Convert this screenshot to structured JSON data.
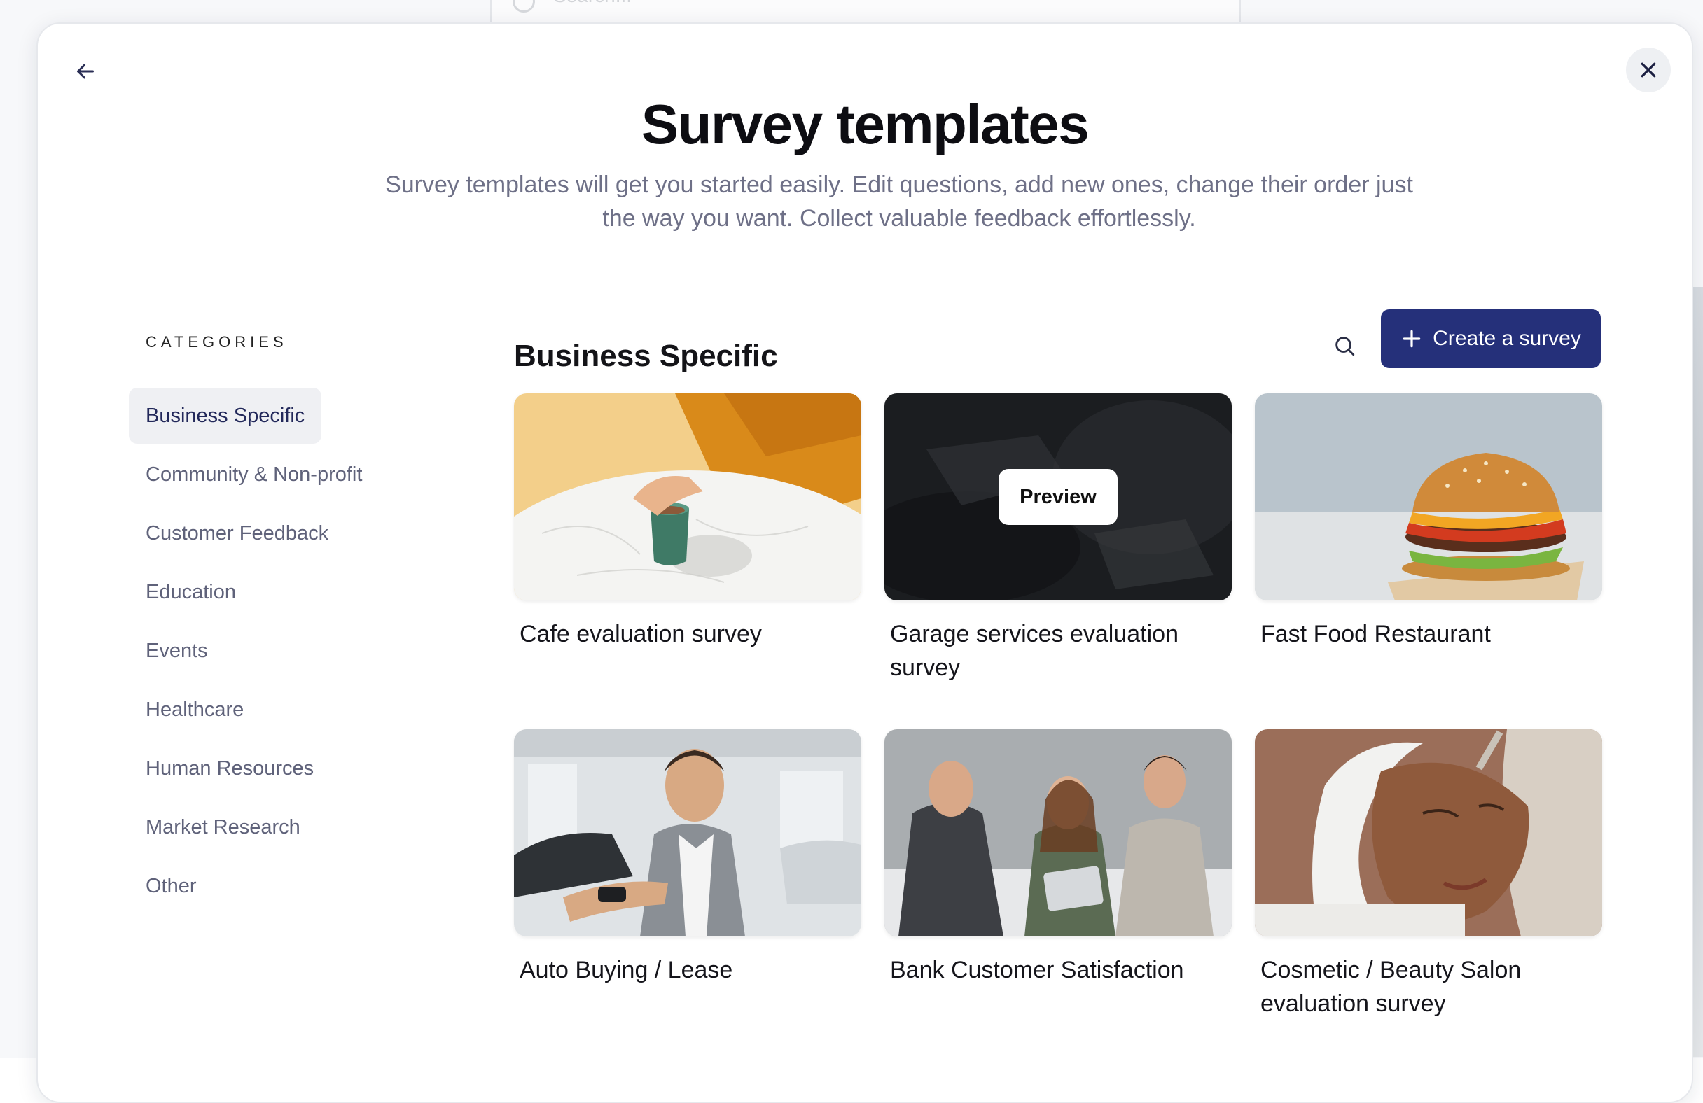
{
  "background": {
    "search_placeholder": "Search..."
  },
  "modal": {
    "title": "Survey templates",
    "subtitle": "Survey templates will get you started easily. Edit questions, add new ones, change their order just the way you want. Collect valuable feedback effortlessly.",
    "icons": {
      "back": "arrow-left-icon",
      "close": "close-icon"
    }
  },
  "sidebar": {
    "heading": "CATEGORIES",
    "items": [
      {
        "label": "Business Specific",
        "active": true
      },
      {
        "label": "Community & Non-profit",
        "active": false
      },
      {
        "label": "Customer Feedback",
        "active": false
      },
      {
        "label": "Education",
        "active": false
      },
      {
        "label": "Events",
        "active": false
      },
      {
        "label": "Healthcare",
        "active": false
      },
      {
        "label": "Human Resources",
        "active": false
      },
      {
        "label": "Market Research",
        "active": false
      },
      {
        "label": "Other",
        "active": false
      }
    ]
  },
  "main": {
    "section_title": "Business Specific",
    "search_icon": "search-icon",
    "create_label": "Create a survey",
    "preview_label": "Preview",
    "templates": [
      {
        "label": "Cafe evaluation survey",
        "image": "coffee-cup-on-marble-table",
        "hovered": false
      },
      {
        "label": "Garage services evaluation survey",
        "image": "mechanic-at-work",
        "hovered": true
      },
      {
        "label": "Fast Food Restaurant",
        "image": "burger",
        "hovered": false
      },
      {
        "label": "Auto Buying / Lease",
        "image": "car-salesman-with-keys",
        "hovered": false
      },
      {
        "label": "Bank Customer Satisfaction",
        "image": "bank-advisor-meeting",
        "hovered": false
      },
      {
        "label": "Cosmetic / Beauty Salon evaluation survey",
        "image": "facial-mask-treatment",
        "hovered": false
      }
    ]
  },
  "colors": {
    "primary": "#25307a",
    "active_bg": "#eff0f3",
    "muted_text": "#6e7087"
  }
}
